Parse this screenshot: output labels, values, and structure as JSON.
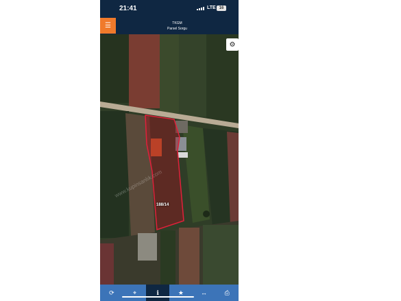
{
  "status_bar": {
    "time": "21:41",
    "network": "LTE",
    "battery": "16"
  },
  "header": {
    "title": "TKGM",
    "subtitle": "Parsel Sorgu",
    "menu_icon": "menu-icon"
  },
  "map": {
    "parcel_label": "188/14",
    "watermark": "www.kupinsanlık.com",
    "settings_icon": "gear-icon"
  },
  "toolbar": {
    "tabs": [
      {
        "icon": "refresh-icon",
        "glyph": "⟳"
      },
      {
        "icon": "locate-icon",
        "glyph": "⌖"
      },
      {
        "icon": "info-icon",
        "glyph": "ℹ"
      },
      {
        "icon": "star-icon",
        "glyph": "★"
      },
      {
        "icon": "measure-icon",
        "glyph": "↔"
      },
      {
        "icon": "print-icon",
        "glyph": "⎙"
      }
    ],
    "active_index": 2
  },
  "colors": {
    "header_bg": "#0f2742",
    "menu_button": "#f07a2b",
    "toolbar_bg": "#3c74b8",
    "parcel_outline": "#e0203a"
  }
}
